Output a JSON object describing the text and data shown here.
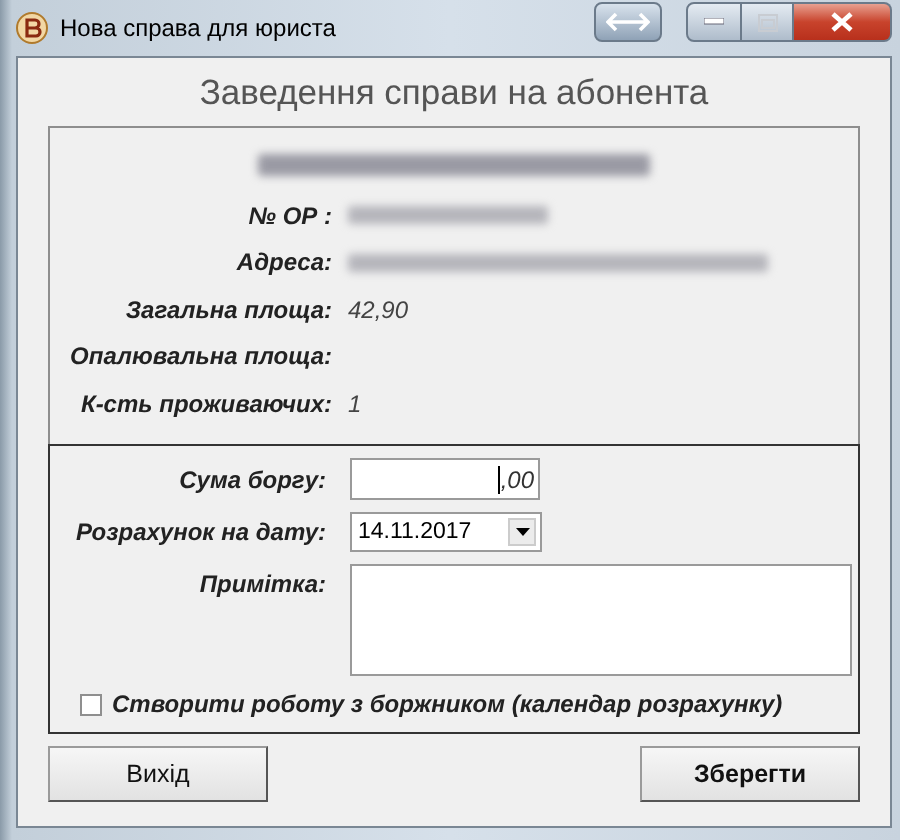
{
  "window": {
    "title": "Нова справа для юриста"
  },
  "heading": "Заведення справи на абонента",
  "info": [
    {
      "kind": "redacted-name"
    },
    {
      "kind": "redacted-row",
      "label": "№ ОР :"
    },
    {
      "kind": "redacted-row",
      "label": "Адреса:"
    },
    {
      "kind": "row",
      "label": "Загальна площа:",
      "value": "42,90"
    },
    {
      "kind": "row",
      "label": "Опалювальна площа:"
    },
    {
      "kind": "row",
      "label": "К-сть проживаючих:",
      "value": "1"
    }
  ],
  "form": {
    "debt": {
      "label": "Сума боргу:",
      "value": ",00"
    },
    "date": {
      "label": "Розрахунок на дату:",
      "value": "14.11.2017"
    },
    "note": {
      "label": "Примітка:"
    },
    "create_work": {
      "label": "Створити роботу з боржником (календар розрахунку)",
      "checked": false
    }
  },
  "buttons": [
    {
      "label": "Вихід",
      "bold": false
    },
    {
      "label": "Зберегти",
      "bold": true
    }
  ]
}
